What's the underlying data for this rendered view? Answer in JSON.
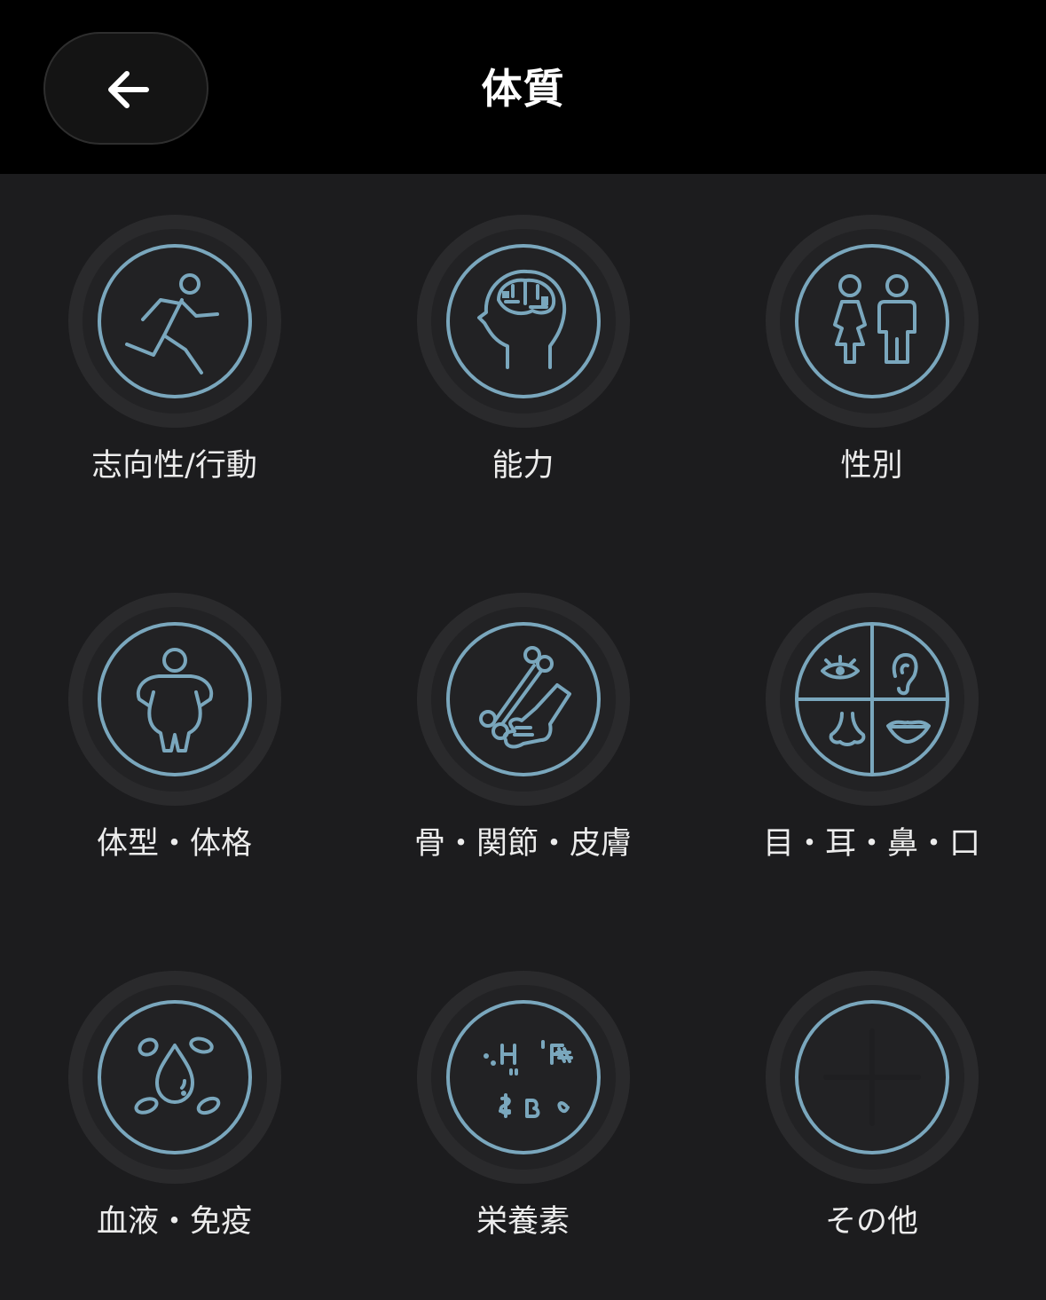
{
  "header": {
    "title": "体質",
    "back_icon": "arrow-left-icon"
  },
  "colors": {
    "accent": "#7aa7bd",
    "background": "#1c1c1e",
    "header_background": "#000000",
    "text": "#ececec"
  },
  "categories": [
    {
      "label": "志向性/行動",
      "icon": "running-person-icon"
    },
    {
      "label": "能力",
      "icon": "brain-head-icon"
    },
    {
      "label": "性別",
      "icon": "gender-icon"
    },
    {
      "label": "体型・体格",
      "icon": "body-shape-icon"
    },
    {
      "label": "骨・関節・皮膚",
      "icon": "bone-skin-icon"
    },
    {
      "label": "目・耳・鼻・口",
      "icon": "senses-icon"
    },
    {
      "label": "血液・免疫",
      "icon": "blood-drop-icon"
    },
    {
      "label": "栄養素",
      "icon": "nutrients-icon"
    },
    {
      "label": "その他",
      "icon": "plus-icon"
    }
  ]
}
